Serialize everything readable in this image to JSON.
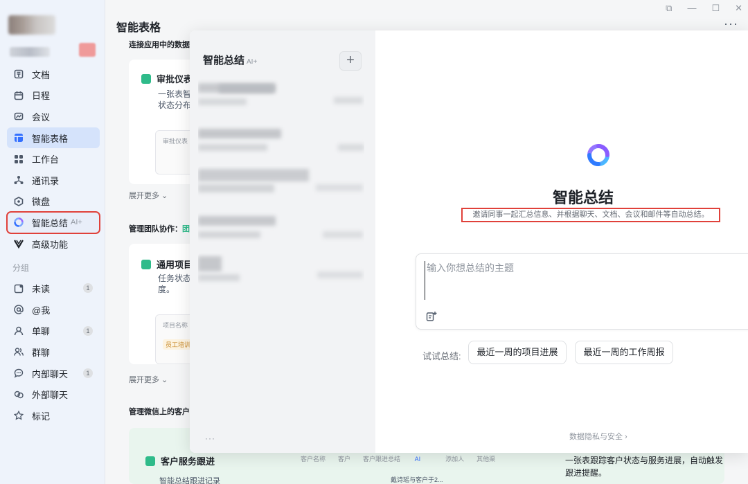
{
  "nav": {
    "items": [
      {
        "label": "文档",
        "icon": "doc-icon"
      },
      {
        "label": "日程",
        "icon": "calendar-icon"
      },
      {
        "label": "会议",
        "icon": "meeting-icon"
      },
      {
        "label": "智能表格",
        "icon": "smart-sheet-icon"
      },
      {
        "label": "工作台",
        "icon": "workbench-icon"
      },
      {
        "label": "通讯录",
        "icon": "contacts-icon"
      },
      {
        "label": "微盘",
        "icon": "drive-icon"
      },
      {
        "label": "智能总结",
        "ai_tag": "AI+",
        "icon": "ai-summary-icon"
      },
      {
        "label": "高级功能",
        "icon": "advanced-icon"
      }
    ],
    "group_label": "分组",
    "groups": [
      {
        "label": "未读",
        "badge": "1",
        "icon": "unread-icon"
      },
      {
        "label": "@我",
        "icon": "at-icon"
      },
      {
        "label": "单聊",
        "badge": "1",
        "icon": "single-chat-icon"
      },
      {
        "label": "群聊",
        "icon": "group-chat-icon"
      },
      {
        "label": "内部聊天",
        "badge": "1",
        "icon": "internal-chat-icon"
      },
      {
        "label": "外部聊天",
        "icon": "external-chat-icon"
      },
      {
        "label": "标记",
        "icon": "star-icon"
      }
    ]
  },
  "main": {
    "title": "智能表格",
    "more": "···",
    "sections": [
      {
        "title": "连接应用中的数据"
      },
      {
        "title": "管理团队协作：",
        "accent": "团"
      },
      {
        "title": "管理微信上的客户"
      }
    ],
    "cards": [
      {
        "title": "审批仪表",
        "desc": [
          "一张表智",
          "状态分布"
        ],
        "mini": "审批仪表"
      },
      {
        "title": "通用项目",
        "desc": [
          "任务状态",
          "度。"
        ],
        "mini": "项目名称",
        "mini_tag": "员工培训"
      }
    ],
    "expand_label": "展开更多",
    "bottom_card": {
      "title": "客户服务跟进",
      "sub": "智能总结跟进记录",
      "columns": [
        "客户名称",
        "客户",
        "客户跟进总结",
        "AI",
        "添加人",
        "其他渠"
      ],
      "row_text": "戴诗瑶与客户于2...",
      "desc": "一张表跟踪客户状态与服务进展，自动触发跟进提醒。"
    }
  },
  "popup": {
    "side": {
      "title": "智能总结",
      "ai_tag": "AI+",
      "new_label": "+",
      "more": "···"
    },
    "main": {
      "title": "智能总结",
      "subtitle": "邀请同事一起汇总信息、并根据聊天、文档、会议和邮件等自动总结。",
      "input_placeholder": "输入你想总结的主题",
      "try_label": "试试总结:",
      "suggestions": [
        "最近一周的项目进展",
        "最近一周的工作周报"
      ],
      "privacy": "数据隐私与安全 ›"
    }
  },
  "colors": {
    "accent": "#3370ff",
    "highlight_border": "#e0413a",
    "sheet_green": "#2fbb8a"
  }
}
